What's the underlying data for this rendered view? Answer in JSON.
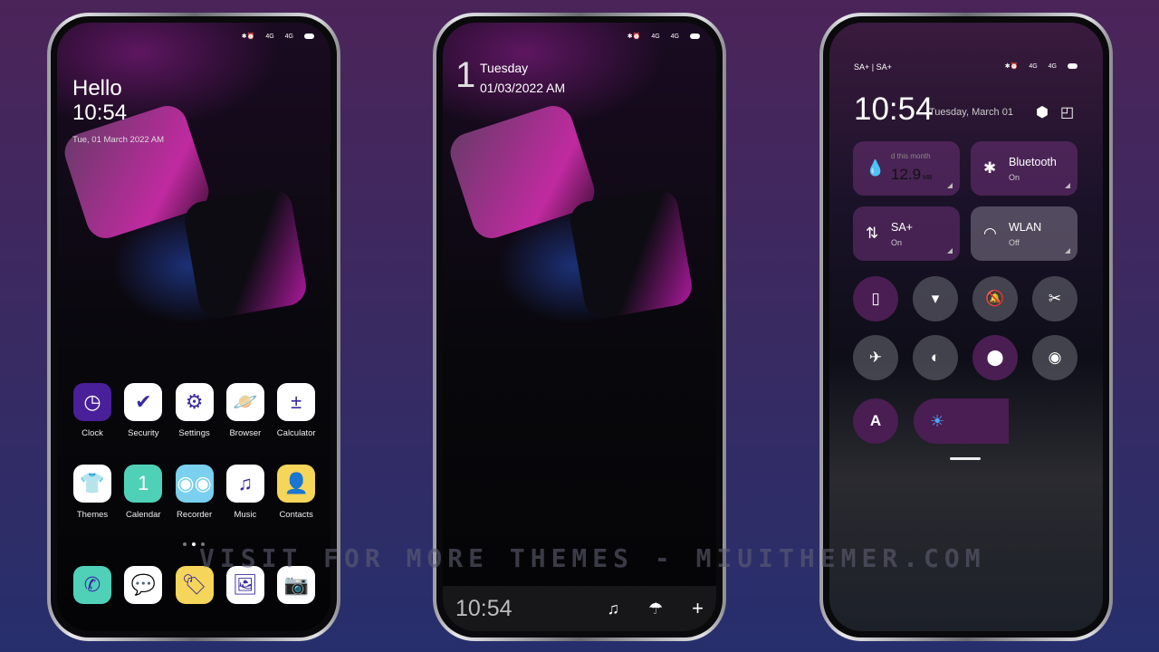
{
  "status": {
    "icons": [
      "bluetooth-icon",
      "alarm-icon",
      "signal-4g-icon",
      "signal-4g-icon",
      "battery-icon"
    ],
    "net": "4G"
  },
  "home": {
    "greeting": "Hello",
    "time": "10:54",
    "date": "Tue, 01 March 2022  AM",
    "apps": [
      {
        "label": "Clock",
        "icon": "clock-icon",
        "bg": "#4a1f9a",
        "glyph": "◷"
      },
      {
        "label": "Security",
        "icon": "shield-check-icon",
        "bg": "#ffffff",
        "glyph": "✔"
      },
      {
        "label": "Settings",
        "icon": "gear-icon",
        "bg": "#ffffff",
        "glyph": "⚙"
      },
      {
        "label": "Browser",
        "icon": "planet-icon",
        "bg": "#ffffff",
        "glyph": "🪐"
      },
      {
        "label": "Calculator",
        "icon": "calculator-icon",
        "bg": "#ffffff",
        "glyph": "±"
      },
      {
        "label": "Themes",
        "icon": "tshirt-icon",
        "bg": "#ffffff",
        "glyph": "👕"
      },
      {
        "label": "Calendar",
        "icon": "calendar-icon",
        "bg": "#4fd1b8",
        "glyph": "1"
      },
      {
        "label": "Recorder",
        "icon": "cassette-icon",
        "bg": "#7ad0ee",
        "glyph": "◉◉"
      },
      {
        "label": "Music",
        "icon": "music-note-icon",
        "bg": "#ffffff",
        "glyph": "♫"
      },
      {
        "label": "Contacts",
        "icon": "contacts-icon",
        "bg": "#f5d55a",
        "glyph": "👤"
      }
    ],
    "dock": [
      {
        "icon": "phone-icon",
        "bg": "#4fd1b8",
        "glyph": "✆"
      },
      {
        "icon": "messages-icon",
        "bg": "#ffffff",
        "glyph": "💬"
      },
      {
        "icon": "tag-icon",
        "bg": "#f5d55a",
        "glyph": "🏷"
      },
      {
        "icon": "gallery-icon",
        "bg": "#ffffff",
        "glyph": "🖼"
      },
      {
        "icon": "camera-icon",
        "bg": "#ffffff",
        "glyph": "📷"
      }
    ],
    "pages": 3,
    "current_page": 2
  },
  "lock": {
    "day_num": "1",
    "weekday": "Tuesday",
    "date": "01/03/2022 AM",
    "bar_time": "10:54",
    "bar_icons": [
      "music-note-icon",
      "umbrella-icon",
      "plus-icon"
    ]
  },
  "control": {
    "carrier": "SA+ | SA+",
    "time": "10:54",
    "date": "Tuesday, March 01",
    "tiles": [
      {
        "title": "12.9",
        "unit": "MB",
        "sub": "d this month",
        "icon": "water-drop-icon"
      },
      {
        "title": "Bluetooth",
        "sub": "On",
        "icon": "bluetooth-icon"
      },
      {
        "title": "SA+",
        "sub": "On",
        "icon": "mobile-data-icon"
      },
      {
        "title": "WLAN",
        "sub": "Off",
        "icon": "wifi-icon"
      }
    ],
    "toggles": [
      {
        "icon": "vibrate-icon",
        "on": true,
        "glyph": "▯"
      },
      {
        "icon": "flashlight-icon",
        "on": false,
        "glyph": "▾"
      },
      {
        "icon": "mute-bell-icon",
        "on": false,
        "glyph": "🔕"
      },
      {
        "icon": "screenshot-scissors-icon",
        "on": false,
        "glyph": "✂"
      },
      {
        "icon": "airplane-icon",
        "on": false,
        "glyph": "✈"
      },
      {
        "icon": "dark-mode-icon",
        "on": false,
        "glyph": "◐"
      },
      {
        "icon": "location-icon",
        "on": true,
        "glyph": "⬤"
      },
      {
        "icon": "eye-icon",
        "on": false,
        "glyph": "◉"
      }
    ],
    "auto_brightness_label": "A",
    "brightness_percent": 45
  },
  "watermark": "VISIT FOR MORE THEMES - MIUITHEMER.COM"
}
